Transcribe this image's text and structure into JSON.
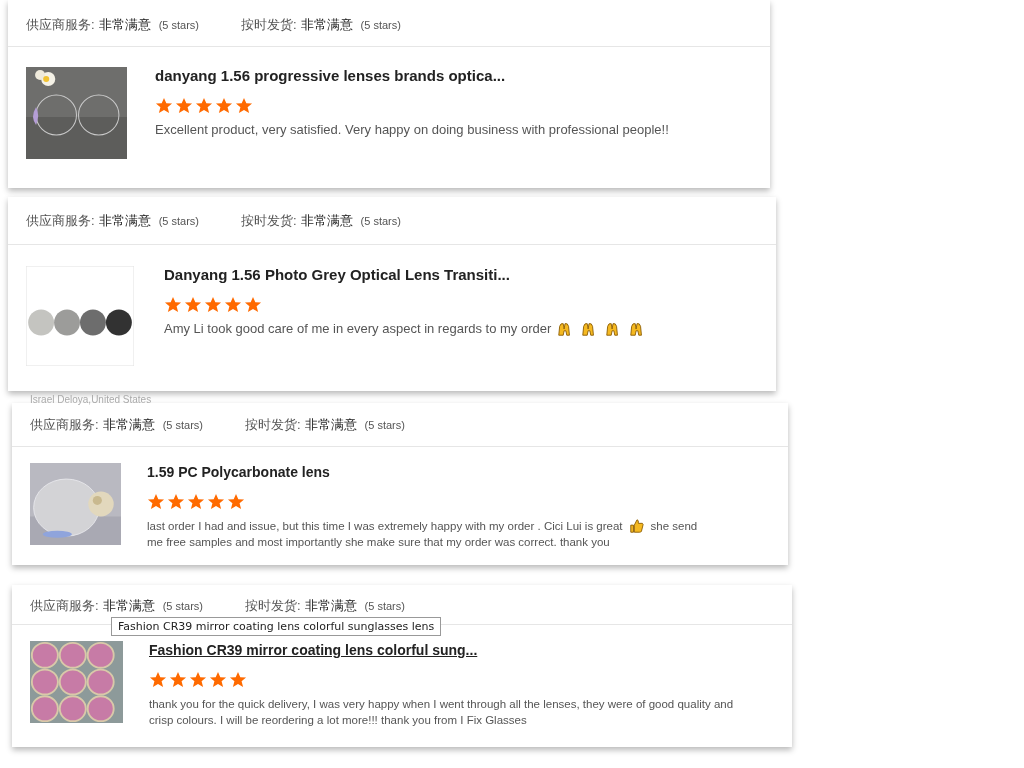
{
  "reviews": [
    {
      "ratings": [
        {
          "label": "供应商服务:",
          "value": "非常满意",
          "note": "(5 stars)"
        },
        {
          "label": "按时发货:",
          "value": "非常满意",
          "note": "(5 stars)"
        }
      ],
      "image": {
        "kind": "picture"
      },
      "title": "danyang 1.56 progressive lenses brands optica...",
      "hovered": false,
      "stars": 5,
      "review": [
        {
          "kind": "text",
          "text": "Excellent product, very satisfied. Very happy on doing business with professional people!!"
        }
      ]
    },
    {
      "ratings": [
        {
          "label": "供应商服务:",
          "value": "非常满意",
          "note": "(5 stars)"
        },
        {
          "label": "按时发货:",
          "value": "非常满意",
          "note": "(5 stars)"
        }
      ],
      "image": {
        "kind": "picture"
      },
      "title": "Danyang 1.56 Photo Grey Optical Lens Transiti...",
      "hovered": false,
      "stars": 5,
      "review": [
        {
          "kind": "text",
          "text": "Amy Li took good care of me in every aspect in regards to my order"
        },
        {
          "kind": "hands"
        },
        {
          "kind": "hands"
        },
        {
          "kind": "hands"
        },
        {
          "kind": "hands"
        }
      ]
    },
    {
      "reviewer": "Israel Deloya,United States",
      "ratings": [
        {
          "label": "供应商服务:",
          "value": "非常满意",
          "note": "(5 stars)"
        },
        {
          "label": "按时发货:",
          "value": "非常满意",
          "note": "(5 stars)"
        }
      ],
      "image": {
        "kind": "picture"
      },
      "title": "1.59 PC Polycarbonate lens",
      "hovered": false,
      "stars": 5,
      "review": [
        {
          "kind": "text",
          "text": "last order I had and issue, but this time I was extremely happy with my order . Cici Lui is great"
        },
        {
          "kind": "thumb"
        },
        {
          "kind": "text",
          "text": "she send"
        },
        {
          "kind": "text",
          "text": "me free samples and most importantly she make sure that my order was correct. thank you"
        }
      ]
    },
    {
      "ratings": [
        {
          "label": "供应商服务:",
          "value": "非常满意",
          "note": "(5 stars)"
        },
        {
          "label": "按时发货:",
          "value": "非常满意",
          "note": "(5 stars)"
        }
      ],
      "image": {
        "kind": "picture"
      },
      "title": "Fashion CR39 mirror coating lens colorful sung...",
      "hovered": true,
      "tooltip": "Fashion CR39 mirror coating lens colorful sunglasses lens",
      "stars": 5,
      "review": [
        {
          "kind": "text",
          "text": "thank you for the quick delivery, I was very happy when I went through all the lenses, they were of good quality and crisp colours.  I will be reordering a lot more!!! thank you from I Fix Glasses"
        }
      ]
    }
  ]
}
